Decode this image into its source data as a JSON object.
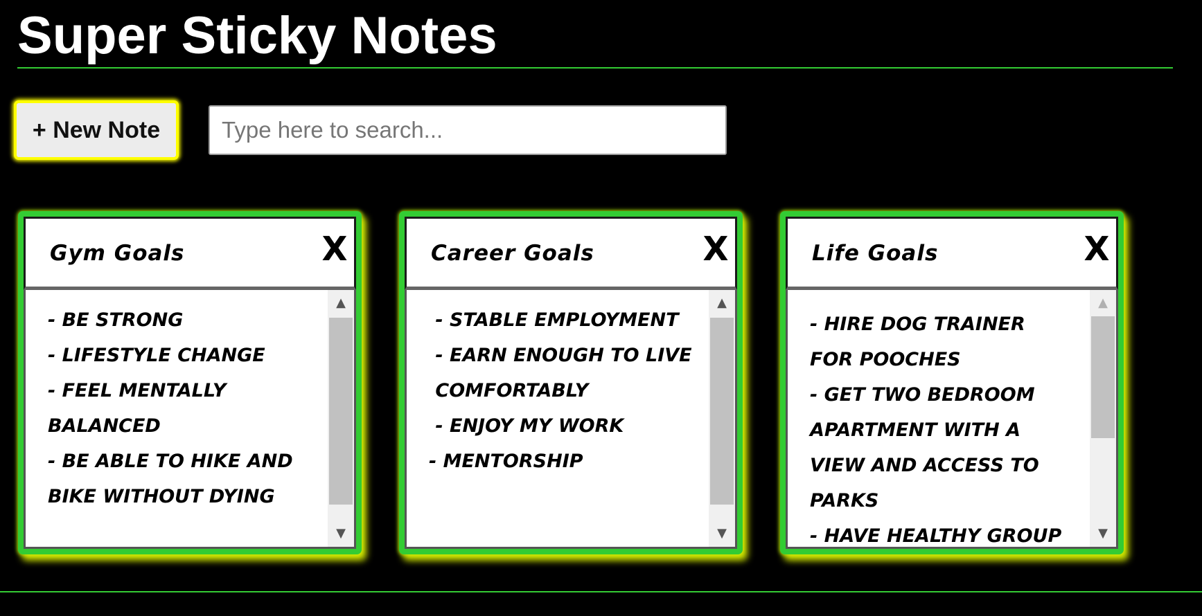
{
  "header": {
    "title": "Super Sticky Notes"
  },
  "toolbar": {
    "new_note_label": "+ New Note",
    "search": {
      "placeholder": "Type here to search...",
      "value": ""
    }
  },
  "notes": [
    {
      "title": "Gym Goals",
      "close_label": "X",
      "description": "- be strong\n- lifestyle change\n- feel mentally balanced\n- be able to hike and bike without dying",
      "scroll_position": 0
    },
    {
      "title": "Career Goals",
      "close_label": "X",
      "description": " - stable employment\n - earn enough to live\n comfortably\n - enjoy my work\n- Mentorship",
      "scroll_position": 0
    },
    {
      "title": "Life Goals",
      "close_label": "X",
      "description": "- hire dog trainer for pooches\n- get two bedroom apartment with a view and access to parks\n- have healthy group",
      "scroll_position": 0
    }
  ],
  "icons": {
    "close": "close-icon",
    "scroll_up": "scroll-up-arrow-icon",
    "scroll_down": "scroll-down-arrow-icon"
  },
  "colors": {
    "background": "#000000",
    "accent_green": "#33cc33",
    "accent_yellow": "#ffff00",
    "title_text": "#ffffff"
  }
}
